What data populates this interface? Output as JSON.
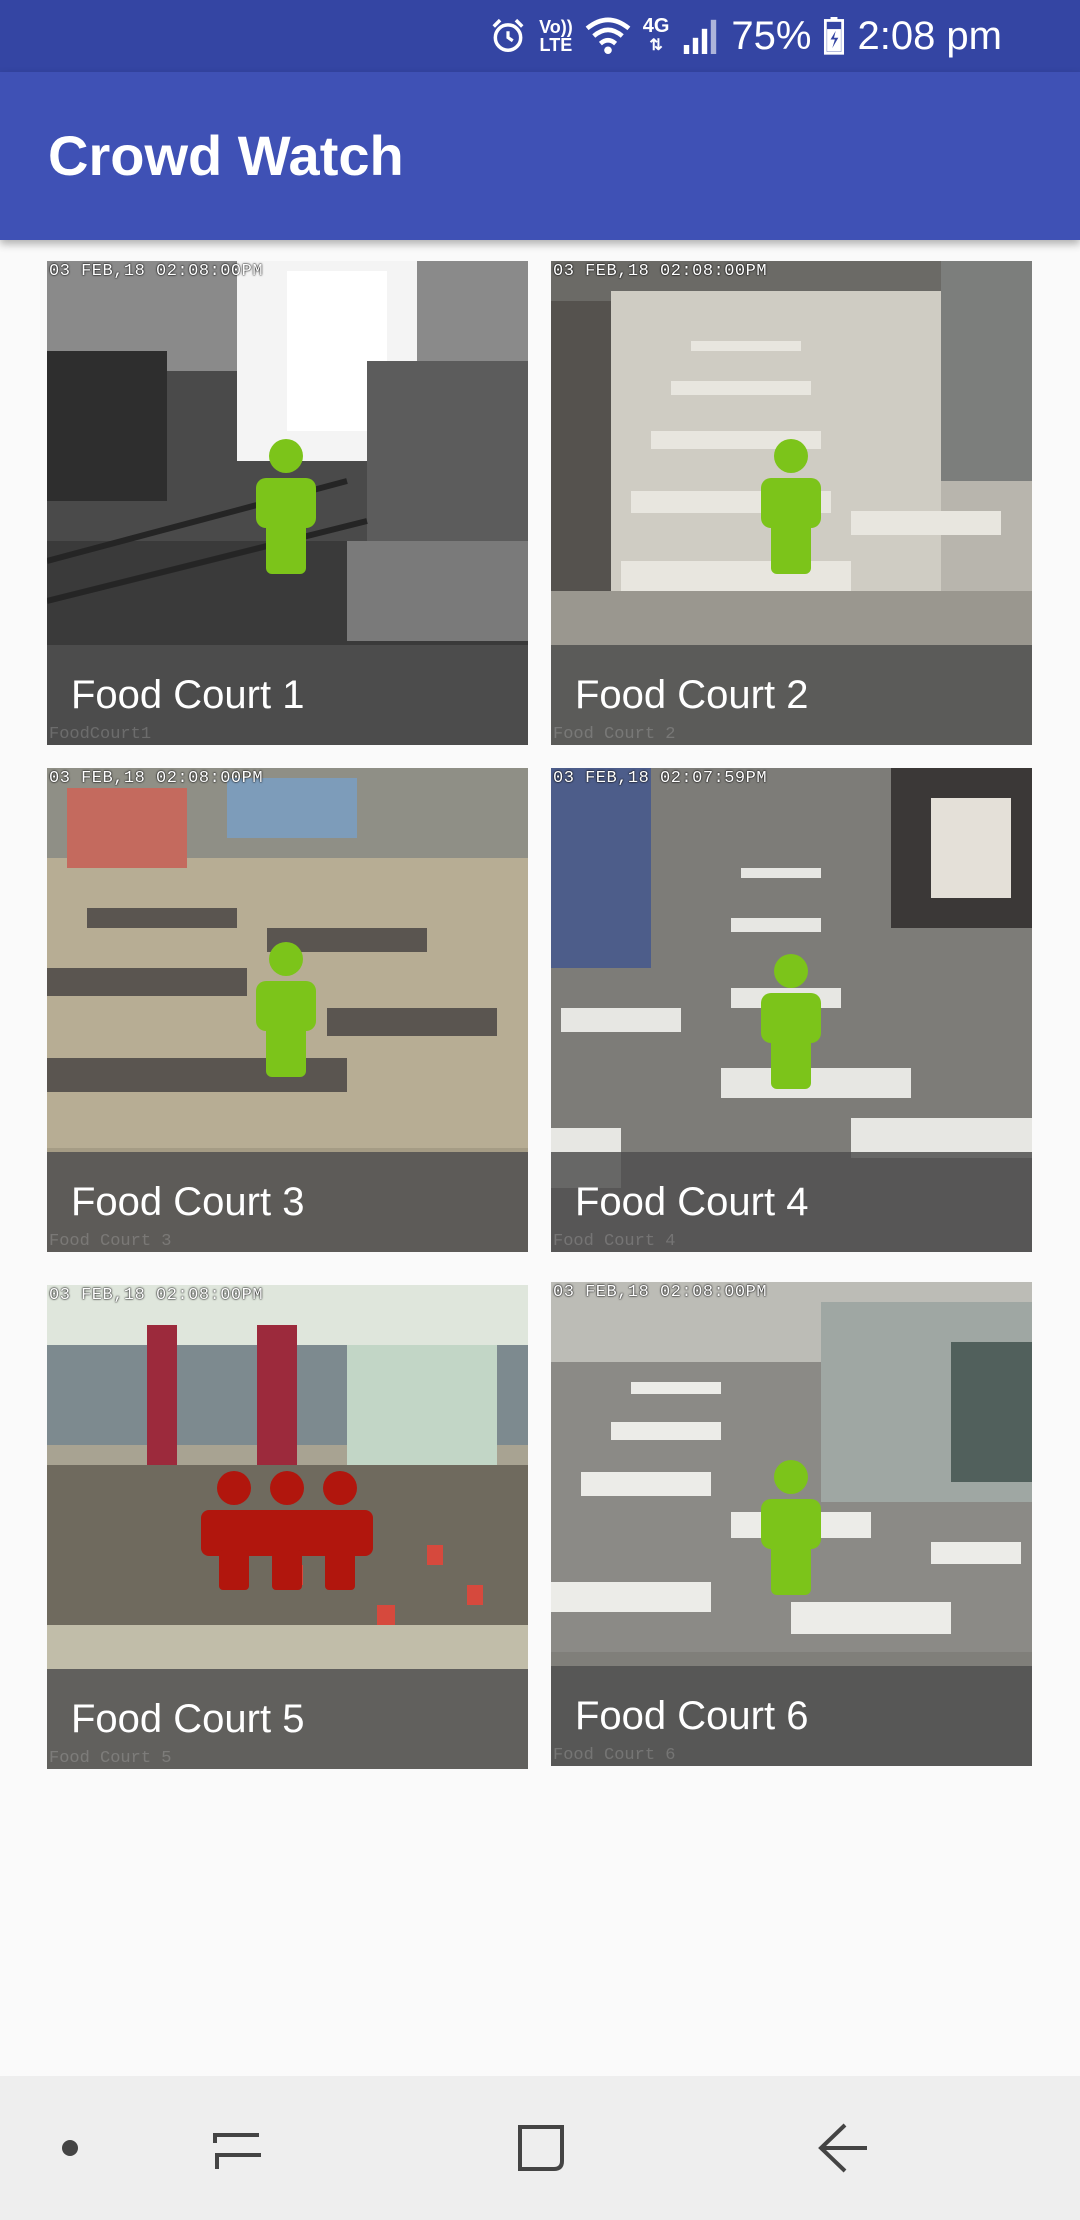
{
  "status_bar": {
    "lte_line1": "Vo))",
    "lte_line2": "LTE",
    "network": "4G",
    "battery": "75%",
    "time": "2:08 pm"
  },
  "app": {
    "title": "Crowd Watch"
  },
  "colors": {
    "status_bar": "#3445a3",
    "app_bar": "#3f51b5",
    "low_crowd": "#7cc41a",
    "high_crowd": "#b1160d"
  },
  "cameras": [
    {
      "name": "Food Court 1",
      "timestamp": "03 FEB,18 02:08:00PM",
      "watermark": "FoodCourt1",
      "crowd_level": "low",
      "crowd_icon": "single-person-icon"
    },
    {
      "name": "Food Court 2",
      "timestamp": "03 FEB,18 02:08:00PM",
      "watermark": "Food Court 2",
      "crowd_level": "low",
      "crowd_icon": "single-person-icon"
    },
    {
      "name": "Food Court 3",
      "timestamp": "03 FEB,18 02:08:00PM",
      "watermark": "Food Court 3",
      "crowd_level": "low",
      "crowd_icon": "single-person-icon"
    },
    {
      "name": "Food Court 4",
      "timestamp": "03 FEB,18 02:07:59PM",
      "watermark": "Food Court 4",
      "crowd_level": "low",
      "crowd_icon": "single-person-icon"
    },
    {
      "name": "Food Court 5",
      "timestamp": "03 FEB,18 02:08:00PM",
      "watermark": "Food Court 5",
      "crowd_level": "high",
      "crowd_icon": "crowd-group-icon"
    },
    {
      "name": "Food Court 6",
      "timestamp": "03 FEB,18 02:08:00PM",
      "watermark": "Food Court 6",
      "crowd_level": "low",
      "crowd_icon": "single-person-icon"
    }
  ],
  "nav_bar": {
    "items": [
      "dot-icon",
      "recent-apps-icon",
      "home-icon",
      "back-icon"
    ]
  }
}
